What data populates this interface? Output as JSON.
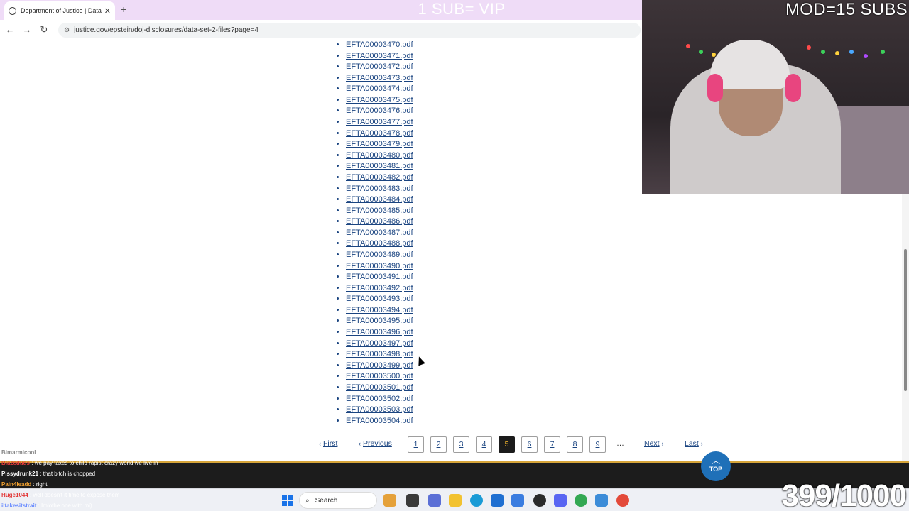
{
  "browser": {
    "tab_title": "Department of Justice | Data Se",
    "url": "justice.gov/epstein/doj-disclosures/data-set-2-files?page=4"
  },
  "stream": {
    "top_banner": "1 SUB= VIP",
    "mod_text": "MOD=15 SUBS",
    "counter": "399/1000"
  },
  "files": [
    "EFTA00003470.pdf",
    "EFTA00003471.pdf",
    "EFTA00003472.pdf",
    "EFTA00003473.pdf",
    "EFTA00003474.pdf",
    "EFTA00003475.pdf",
    "EFTA00003476.pdf",
    "EFTA00003477.pdf",
    "EFTA00003478.pdf",
    "EFTA00003479.pdf",
    "EFTA00003480.pdf",
    "EFTA00003481.pdf",
    "EFTA00003482.pdf",
    "EFTA00003483.pdf",
    "EFTA00003484.pdf",
    "EFTA00003485.pdf",
    "EFTA00003486.pdf",
    "EFTA00003487.pdf",
    "EFTA00003488.pdf",
    "EFTA00003489.pdf",
    "EFTA00003490.pdf",
    "EFTA00003491.pdf",
    "EFTA00003492.pdf",
    "EFTA00003493.pdf",
    "EFTA00003494.pdf",
    "EFTA00003495.pdf",
    "EFTA00003496.pdf",
    "EFTA00003497.pdf",
    "EFTA00003498.pdf",
    "EFTA00003499.pdf",
    "EFTA00003500.pdf",
    "EFTA00003501.pdf",
    "EFTA00003502.pdf",
    "EFTA00003503.pdf",
    "EFTA00003504.pdf"
  ],
  "pagination": {
    "first": "First",
    "previous": "Previous",
    "pages": [
      "1",
      "2",
      "3",
      "4",
      "5",
      "6",
      "7",
      "8",
      "9"
    ],
    "current": "5",
    "ellipsis": "…",
    "next": "Next",
    "last": "Last"
  },
  "top_button": {
    "label": "TOP"
  },
  "chat": [
    {
      "user": "Bimarmicool",
      "message": "",
      "color": "#888888"
    },
    {
      "user": "Blazeduds",
      "message": "we pay taxes to child rapist crazy world we live in",
      "color": "#e33b3b"
    },
    {
      "user": "Pissydrunk21",
      "message": "that bitch is chopped",
      "color": "#ffffff"
    },
    {
      "user": "Pain4leadd",
      "message": "right",
      "color": "#f0a030"
    },
    {
      "user": "Huge1044",
      "message": "well doesn't it time to expose them",
      "color": "#e33b3b"
    },
    {
      "user": "iltakesitstrait",
      "message": "Imlothe one with mi)",
      "color": "#6a8cff"
    }
  ],
  "taskbar": {
    "search_placeholder": "Search"
  },
  "colors": {
    "link": "#1a4480",
    "current_page_bg": "#1b1b1b",
    "current_page_text": "#ffbe2e",
    "top_button": "#1f70b8",
    "tabbar": "#efdcf7"
  }
}
